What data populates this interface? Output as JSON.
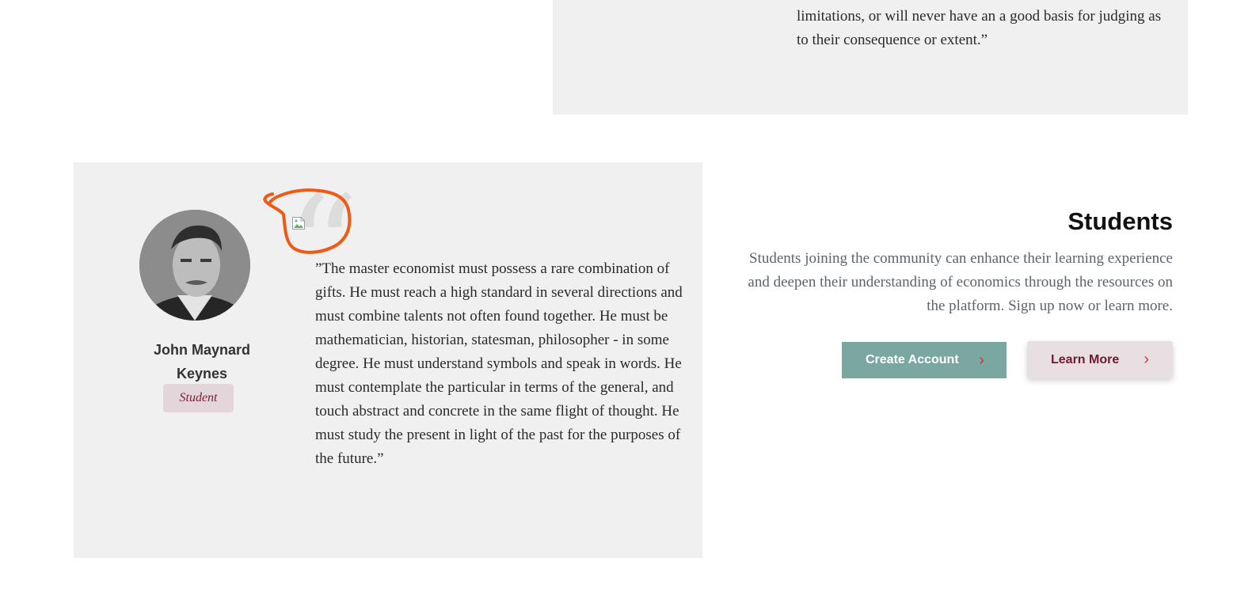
{
  "top_card": {
    "quote_text": "limitations, or will never have an a good basis for judging as to their consequence or extent.”"
  },
  "testimonial": {
    "person_name": "John Maynard Keynes",
    "role": "Student",
    "quote_mark": "“",
    "quote_text": "”The master economist must possess a rare combination of gifts. He must reach a high standard in several directions and must combine talents not often found together. He must be mathematician, historian, statesman, philosopher - in some degree. He must understand symbols and speak in words. He must contemplate the particular in terms of the general, and touch abstract and concrete in the same flight of thought. He must study the present in light of the past for the purposes of the future.”"
  },
  "students": {
    "title": "Students",
    "description": "Students joining the community can enhance their learning experience and deepen their understanding of economics through the resources on the platform. Sign up now or learn more.",
    "create_account_label": "Create Account",
    "learn_more_label": "Learn More",
    "chevron": "›"
  },
  "colors": {
    "card_background": "#f0f0f0",
    "create_button": "#7aa8a0",
    "learn_button": "#e8dfe2",
    "accent_burgundy": "#7a1d33",
    "annotation": "#f05a14"
  },
  "icons": {
    "avatar": "portrait-photo",
    "broken_image": "broken-image-icon",
    "chevron": "chevron-right-icon"
  }
}
